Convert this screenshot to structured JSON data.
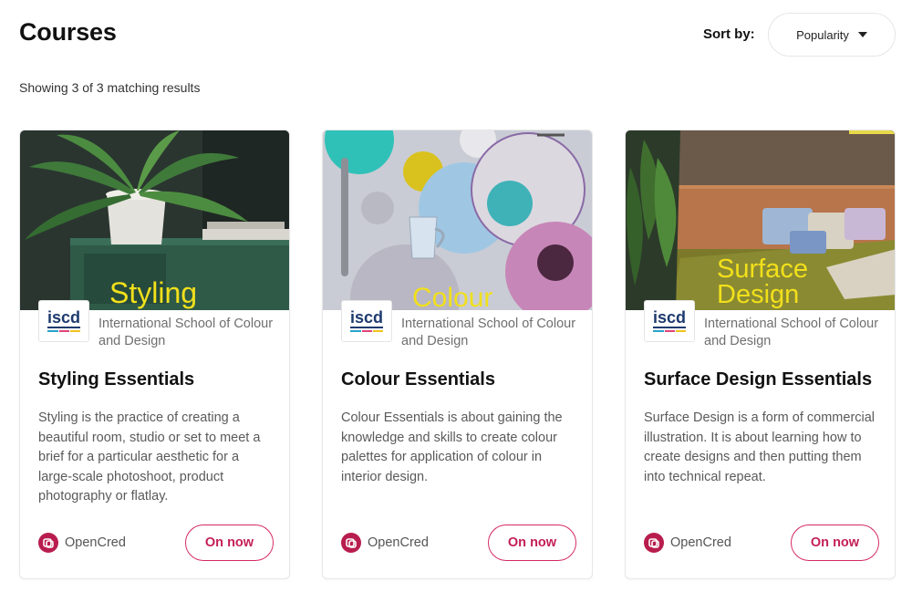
{
  "header": {
    "title": "Courses",
    "sort_label": "Sort by:",
    "sort_value": "Popularity",
    "results_text": "Showing 3 of 3 matching results"
  },
  "logo_text": "iscd",
  "courses": [
    {
      "image_caption": "Styling",
      "institution": "International School of Colour and Design",
      "title": "Styling Essentials",
      "description": "Styling is the practice of creating a beautiful room, studio or set to meet a brief for a particular aesthetic for a large-scale photoshoot, product photography or flatlay.",
      "provider": "OpenCred",
      "status": "On now"
    },
    {
      "image_caption": "Colour",
      "institution": "International School of Colour and Design",
      "title": "Colour Essentials",
      "description": "Colour Essentials is about gaining the knowledge and skills to create colour palettes for application of colour in interior design.",
      "provider": "OpenCred",
      "status": "On now"
    },
    {
      "image_caption": "Surface Design",
      "institution": "International School of Colour and Design",
      "title": "Surface Design Essentials",
      "description": "Surface Design is a form of commercial illustration. It is about learning how to create designs and then putting them into technical repeat.",
      "provider": "OpenCred",
      "status": "On now"
    }
  ],
  "colors": {
    "accent": "#c41f55",
    "caption_yellow": "#f2e01b",
    "logo_navy": "#1d3a6e"
  }
}
